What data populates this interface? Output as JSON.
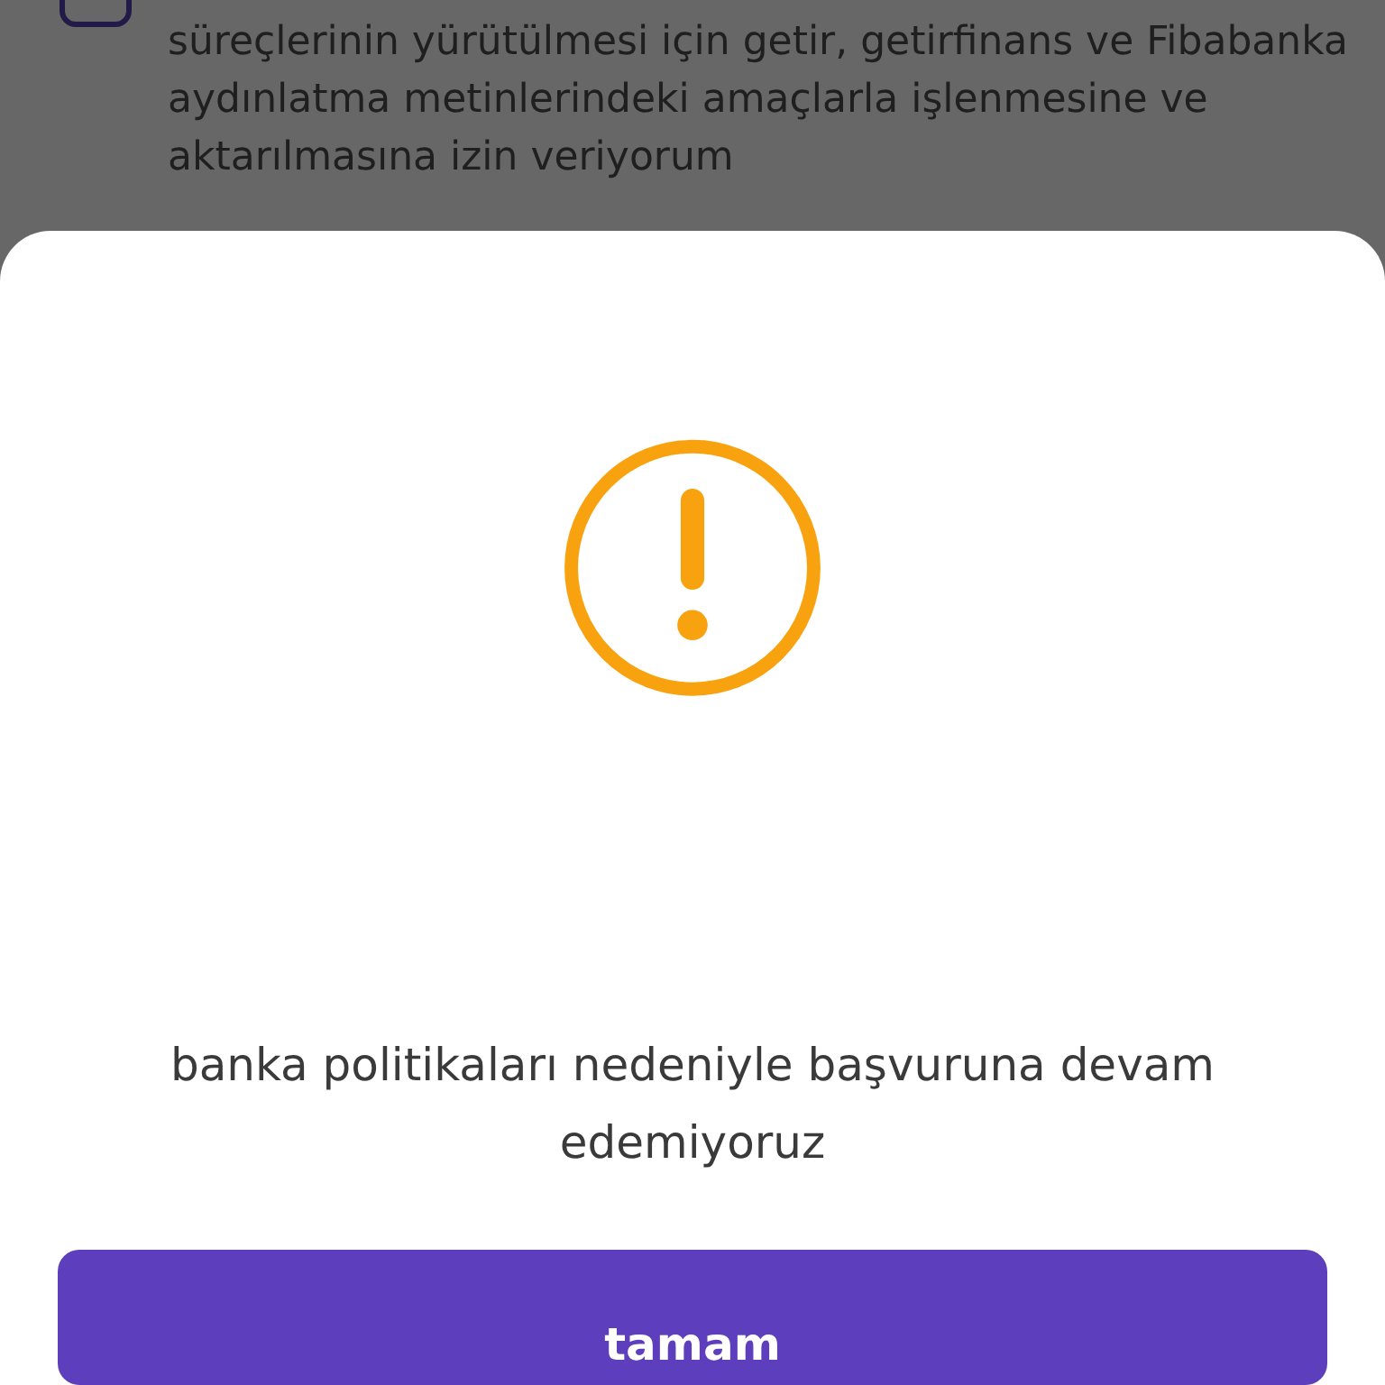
{
  "consent": {
    "checked": false,
    "lines": [
      "süreçlerinin yürütülmesi için getir, getirfinans ve Fibabanka",
      "aydınlatma metinlerindeki amaçlarla işlenmesine ve",
      "aktarılmasına izin veriyorum"
    ]
  },
  "dialog": {
    "message": "banka politikaları nedeniyle başvuruna devam edemiyoruz",
    "button": "tamam"
  }
}
